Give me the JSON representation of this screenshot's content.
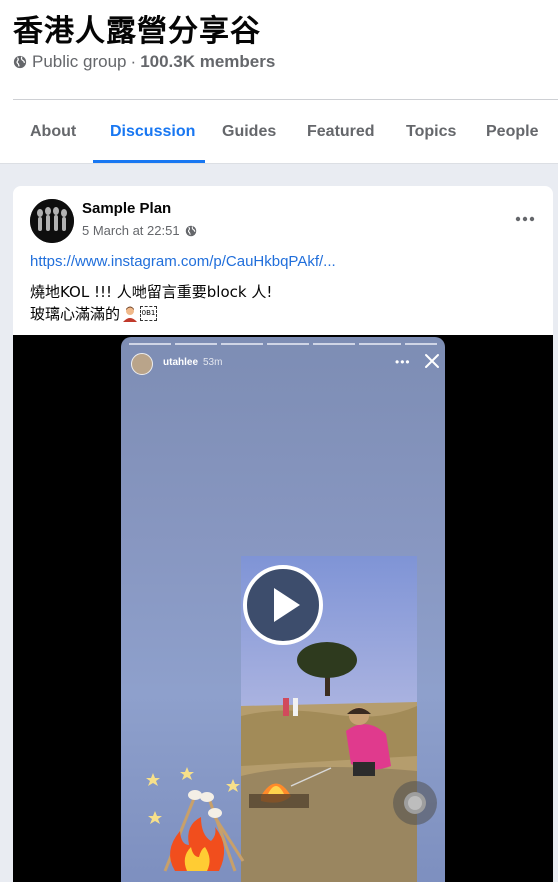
{
  "group": {
    "name": "香港人露營分享谷",
    "privacy": "Public group",
    "separator": "·",
    "members": "100.3K members"
  },
  "tabs": [
    {
      "label": "About",
      "active": false
    },
    {
      "label": "Discussion",
      "active": true
    },
    {
      "label": "Guides",
      "active": false
    },
    {
      "label": "Featured",
      "active": false
    },
    {
      "label": "Topics",
      "active": false
    },
    {
      "label": "People",
      "active": false
    }
  ],
  "post": {
    "author": "Sample Plan",
    "timestamp": "5 March at 22:51",
    "link": "https://www.instagram.com/p/CauHkbqPAkf/...",
    "line1": "燒地KOL !!! 人哋留言重要block 人!",
    "line2": "玻璃心滿滿的",
    "tofu_glyph": "0B1"
  },
  "story": {
    "username": "utahlee",
    "time": "53m"
  },
  "colors": {
    "accent": "#1877f2",
    "link": "#216fdb",
    "muted": "#65676b",
    "page_bg": "#e9ecf2"
  },
  "icons": [
    "globe-icon",
    "more-icon",
    "close-icon",
    "play-icon",
    "fire-emoji-icon",
    "person-emoji-icon"
  ]
}
